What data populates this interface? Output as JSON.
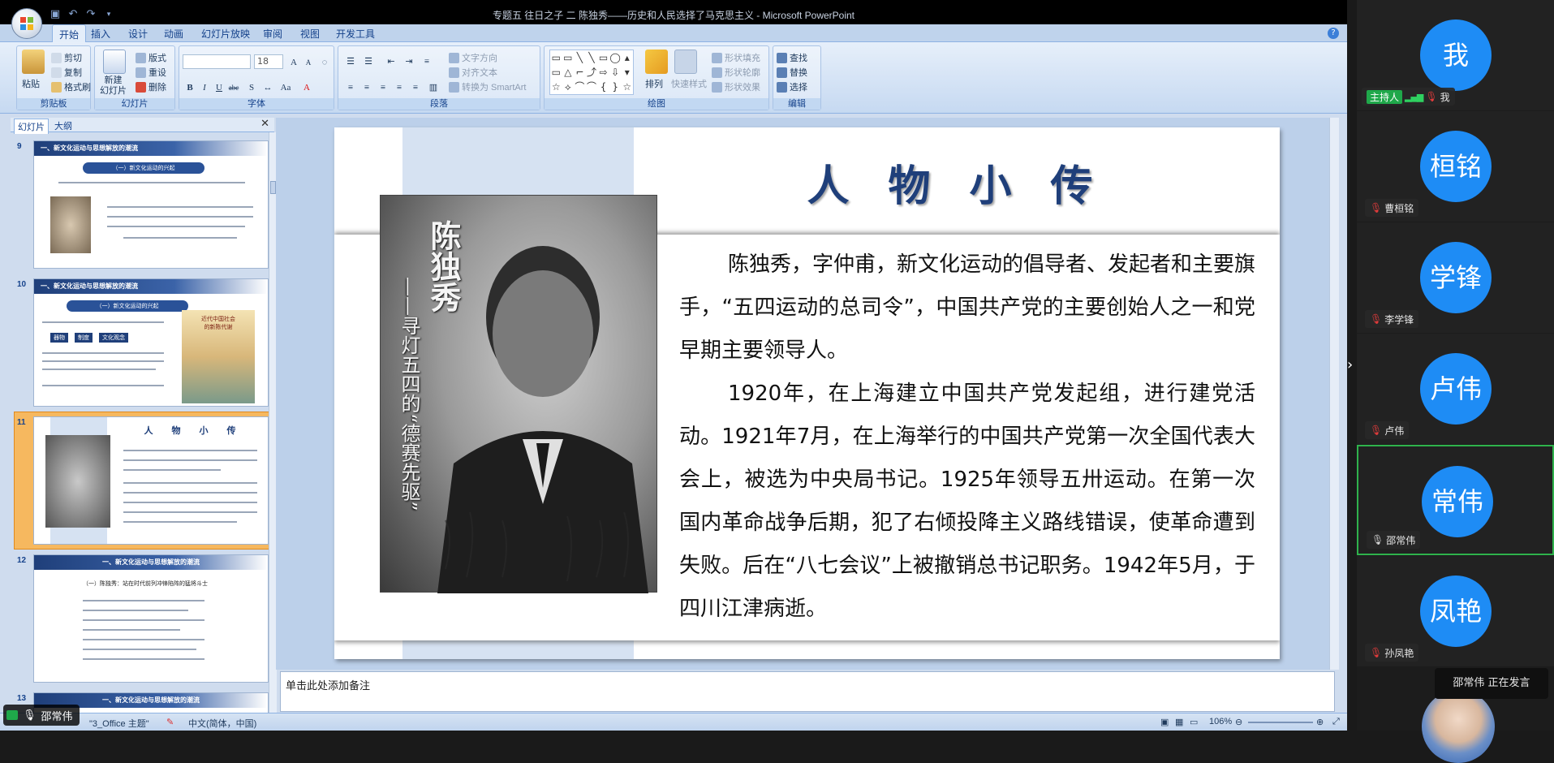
{
  "window": {
    "title": "专题五 往日之子 二 陈独秀——历史和人民选择了马克思主义 - Microsoft PowerPoint"
  },
  "ribbon": {
    "tabs": [
      "开始",
      "插入",
      "设计",
      "动画",
      "幻灯片放映",
      "审阅",
      "视图",
      "开发工具"
    ],
    "active_tab": "开始",
    "clipboard": {
      "paste": "粘贴",
      "cut": "剪切",
      "copy": "复制",
      "format_painter": "格式刷",
      "label": "剪贴板"
    },
    "slides": {
      "new_slide": "新建\n幻灯片",
      "layout": "版式",
      "reset": "重设",
      "delete": "删除",
      "label": "幻灯片"
    },
    "font": {
      "size": "18",
      "bold": "B",
      "italic": "I",
      "underline": "U",
      "strike": "abc",
      "shadow": "S",
      "label": "字体"
    },
    "paragraph": {
      "text_direction": "文字方向",
      "align_text": "对齐文本",
      "smartart": "转换为 SmartArt",
      "label": "段落"
    },
    "drawing": {
      "arrange": "排列",
      "quick_styles": "快速样式",
      "shape_fill": "形状填充",
      "shape_outline": "形状轮廓",
      "shape_effects": "形状效果",
      "label": "绘图"
    },
    "editing": {
      "find": "查找",
      "replace": "替换",
      "select": "选择",
      "label": "编辑"
    }
  },
  "panel": {
    "tabs": [
      "幻灯片",
      "大纲"
    ],
    "thumbs": [
      {
        "num": "9",
        "head": "一、新文化运动与思想解放的潮流",
        "pill": "（一）新文化运动的兴起"
      },
      {
        "num": "10",
        "head": "一、新文化运动与思想解放的潮流",
        "pill": "（一）新文化运动的兴起",
        "book": "近代中国社会\n的新陈代谢",
        "flow": [
          "器物",
          "制度",
          "文化观念"
        ]
      },
      {
        "num": "11",
        "head": "人　物　小　传",
        "selected": true
      },
      {
        "num": "12",
        "head": "一、新文化运动与思想解放的潮流",
        "sub": "（一）陈独秀：站在时代前列冲锋陷阵的猛将斗士"
      },
      {
        "num": "13",
        "head": "一、新文化运动与思想解放的潮流"
      }
    ]
  },
  "slide": {
    "title": "人物小传",
    "portrait_caption": "陈独秀",
    "portrait_subtitle": "——寻灯五四的“德赛先驱”",
    "paragraph1": "陈独秀，字仲甫，新文化运动的倡导者、发起者和主要旗手，“五四运动的总司令”，中国共产党的主要创始人之一和党早期主要领导人。",
    "paragraph2": "1920年，在上海建立中国共产党发起组，进行建党活动。1921年7月，在上海举行的中国共产党第一次全国代表大会上，被选为中央局书记。1925年领导五卅运动。在第一次国内革命战争后期，犯了右倾投降主义路线错误，使革命遭到失败。后在“八七会议”上被撤销总书记职务。1942年5月，于四川江津病逝。"
  },
  "notes": {
    "placeholder": "单击此处添加备注"
  },
  "status": {
    "theme": "\"3_Office 主题\"",
    "language": "中文(简体，中国)",
    "zoom": "106%"
  },
  "overlay_user": "邵常伟",
  "participants": [
    {
      "avatar": "我",
      "name": "我",
      "host_badge": "主持人",
      "muted": true
    },
    {
      "avatar": "桓铭",
      "name": "曹桓铭",
      "muted": true
    },
    {
      "avatar": "学锋",
      "name": "李学锋",
      "muted": true
    },
    {
      "avatar": "卢伟",
      "name": "卢伟",
      "muted": true
    },
    {
      "avatar": "常伟",
      "name": "邵常伟",
      "muted": false,
      "speaking": true
    },
    {
      "avatar": "凤艳",
      "name": "孙凤艳",
      "muted": true
    }
  ],
  "speaking_tip": "邵常伟  正在发言",
  "colors": {
    "accent": "#1e8cf5",
    "title_blue": "#1f3f7a",
    "speaking_border": "#2fb24c",
    "selected_thumb": "#f6b85f"
  }
}
